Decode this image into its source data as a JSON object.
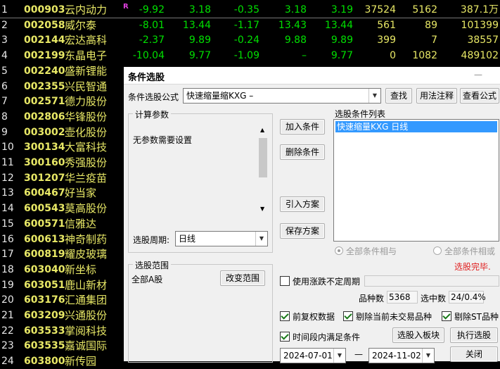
{
  "stocks": [
    {
      "idx": "1",
      "code": "000903",
      "name": "云内动力",
      "c1": "-9.92",
      "c2": "3.18",
      "c3": "-0.35",
      "c4": "3.18",
      "c5": "3.19",
      "c6": "37524",
      "c7": "5162",
      "c8": "387.1万",
      "mark": "R"
    },
    {
      "idx": "2",
      "code": "002058",
      "name": "威尔泰",
      "c1": "-8.01",
      "c2": "13.44",
      "c3": "-1.17",
      "c4": "13.43",
      "c5": "13.44",
      "c6": "561",
      "c7": "89",
      "c8": "101399"
    },
    {
      "idx": "3",
      "code": "002144",
      "name": "宏达高科",
      "c1": "-2.37",
      "c2": "9.89",
      "c3": "-0.24",
      "c4": "9.88",
      "c5": "9.89",
      "c6": "399",
      "c7": "7",
      "c8": "38557"
    },
    {
      "idx": "4",
      "code": "002199",
      "name": "东晶电子",
      "c1": "-10.04",
      "c2": "9.77",
      "c3": "-1.09",
      "c4": "–",
      "c5": "9.77",
      "c6": "0",
      "c7": "1082",
      "c8": "489102"
    },
    {
      "idx": "5",
      "code": "002240",
      "name": "盛新锂能"
    },
    {
      "idx": "6",
      "code": "002355",
      "name": "兴民智通"
    },
    {
      "idx": "7",
      "code": "002571",
      "name": "德力股份"
    },
    {
      "idx": "8",
      "code": "002806",
      "name": "华锋股份"
    },
    {
      "idx": "9",
      "code": "003002",
      "name": "壶化股份"
    },
    {
      "idx": "10",
      "code": "300134",
      "name": "大富科技"
    },
    {
      "idx": "11",
      "code": "300160",
      "name": "秀强股份"
    },
    {
      "idx": "12",
      "code": "301207",
      "name": "华兰疫苗"
    },
    {
      "idx": "13",
      "code": "600467",
      "name": "好当家"
    },
    {
      "idx": "14",
      "code": "600543",
      "name": "莫高股份"
    },
    {
      "idx": "15",
      "code": "600571",
      "name": "信雅达"
    },
    {
      "idx": "16",
      "code": "600613",
      "name": "神奇制药"
    },
    {
      "idx": "17",
      "code": "600819",
      "name": "耀皮玻璃"
    },
    {
      "idx": "18",
      "code": "603040",
      "name": "新坐标"
    },
    {
      "idx": "19",
      "code": "603051",
      "name": "鹿山新材"
    },
    {
      "idx": "20",
      "code": "603176",
      "name": "汇通集团"
    },
    {
      "idx": "21",
      "code": "603209",
      "name": "兴通股份"
    },
    {
      "idx": "22",
      "code": "603533",
      "name": "掌阅科技"
    },
    {
      "idx": "23",
      "code": "603535",
      "name": "嘉诚国际"
    },
    {
      "idx": "24",
      "code": "603800",
      "name": "新传园"
    }
  ],
  "dialog": {
    "title": "条件选股",
    "minimize": "—",
    "formula_label": "条件选股公式",
    "formula_value": "快速缩量缩KXG  –",
    "btn_find": "查找",
    "btn_usage": "用法注释",
    "btn_view": "查看公式",
    "params_group": "计算参数",
    "params_text": "无参数需要设置",
    "period_label": "选股周期:",
    "period_value": "日线",
    "btn_add": "加入条件",
    "btn_delete": "删除条件",
    "btn_import": "引入方案",
    "btn_save": "保存方案",
    "list_label": "选股条件列表",
    "list_items": [
      "快速缩量KXG   日线"
    ],
    "radio_and": "全部条件相与",
    "radio_or": "全部条件相或",
    "status": "选股完毕.",
    "range_group": "选股范围",
    "range_value": "全部A股",
    "btn_change_range": "改变范围",
    "use_period_label": "使用涨跌不定周期",
    "count_label": "品种数",
    "count_value": "5368",
    "hit_label": "选中数",
    "hit_value": "24/0.4%",
    "fq_label": "前复权数据",
    "exclude_label": "剔除当前未交易品种",
    "st_label": "剔除ST品种",
    "time_label": "时间段内满足条件",
    "btn_to_block": "选股入板块",
    "btn_exec": "执行选股",
    "date_from": "2024-07-01",
    "date_sep": "—",
    "date_to": "2024-11-02",
    "btn_close": "关闭"
  },
  "colors": {
    "accent": "#3399ff",
    "status": "#e02020",
    "up": "#00e000",
    "code": "#e8e866"
  }
}
